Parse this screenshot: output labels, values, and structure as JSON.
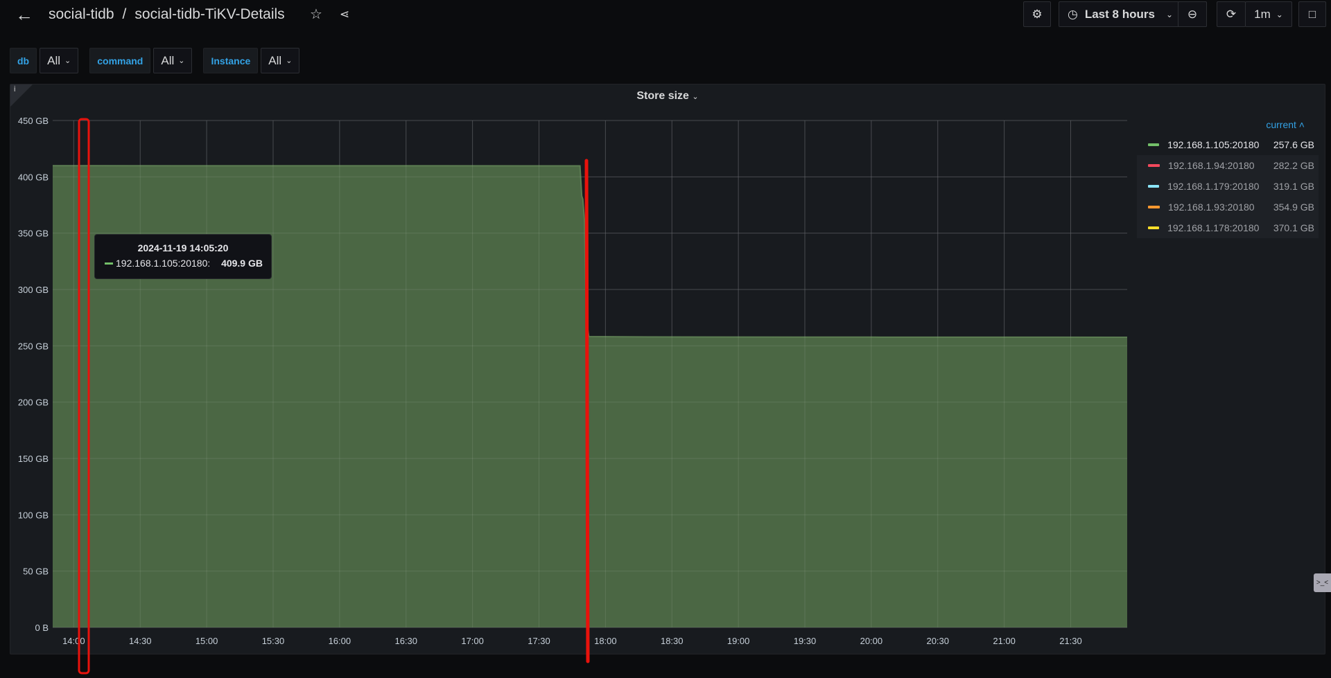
{
  "header": {
    "back_icon": "arrow-left-icon",
    "folder": "social-tidb",
    "separator": "/",
    "title": "social-tidb-TiKV-Details",
    "star_icon": "star-icon",
    "share_icon": "share-icon"
  },
  "toolbar": {
    "settings_icon": "gear-icon",
    "time_range": "Last 8 hours",
    "clock_icon": "clock-icon",
    "zoom_out_icon": "zoom-out-icon",
    "refresh_icon": "refresh-icon",
    "refresh_interval": "1m",
    "tv_icon": "monitor-icon"
  },
  "variables": [
    {
      "label": "db",
      "value": "All"
    },
    {
      "label": "command",
      "value": "All"
    },
    {
      "label": "Instance",
      "value": "All"
    }
  ],
  "panel": {
    "title": "Store size",
    "info": "i"
  },
  "legend": {
    "header": "current",
    "items": [
      {
        "name": "192.168.1.105:20180",
        "value": "257.6 GB",
        "color": "#73bf69"
      },
      {
        "name": "192.168.1.94:20180",
        "value": "282.2 GB",
        "color": "#f2495c"
      },
      {
        "name": "192.168.1.179:20180",
        "value": "319.1 GB",
        "color": "#8ae4f7"
      },
      {
        "name": "192.168.1.93:20180",
        "value": "354.9 GB",
        "color": "#ff9830"
      },
      {
        "name": "192.168.1.178:20180",
        "value": "370.1 GB",
        "color": "#fade2a"
      }
    ]
  },
  "tooltip": {
    "time": "2024-11-19 14:05:20",
    "series": "192.168.1.105:20180:",
    "value": "409.9 GB"
  },
  "side_widget": ">_<",
  "chart_data": {
    "type": "area",
    "title": "Store size",
    "xlabel": "",
    "ylabel": "",
    "ylim": [
      0,
      450
    ],
    "y_unit": "GB",
    "yticks": [
      "0 B",
      "50 GB",
      "100 GB",
      "150 GB",
      "200 GB",
      "250 GB",
      "300 GB",
      "350 GB",
      "400 GB",
      "450 GB"
    ],
    "xlim_minutes": [
      830.5,
      1315.5
    ],
    "xticks": [
      "14:00",
      "14:30",
      "15:00",
      "15:30",
      "16:00",
      "16:30",
      "17:00",
      "17:30",
      "18:00",
      "18:30",
      "19:00",
      "19:30",
      "20:00",
      "20:30",
      "21:00",
      "21:30"
    ],
    "grid": true,
    "legend_placement": "right",
    "series": [
      {
        "name": "192.168.1.105:20180",
        "color": "#73bf69",
        "x_minutes": [
          830.5,
          900,
          1000,
          1068.5,
          1069.3,
          1069.8,
          1070.5,
          1071.3,
          1072.5,
          1100,
          1200,
          1315.5
        ],
        "values": [
          409.9,
          409.8,
          409.8,
          409.7,
          383,
          380,
          362,
          275,
          258.2,
          257.9,
          257.7,
          257.6
        ]
      }
    ]
  }
}
